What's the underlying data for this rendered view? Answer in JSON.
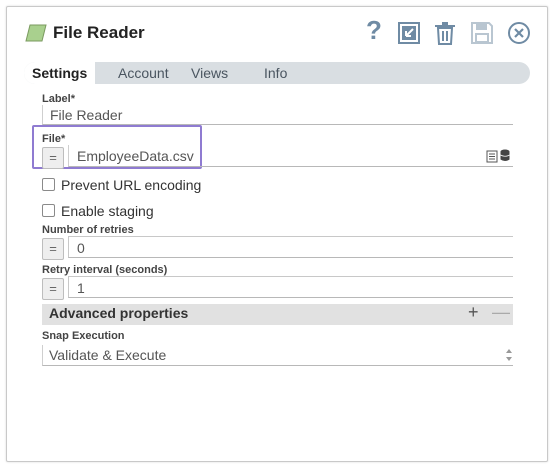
{
  "dialog": {
    "title": "File Reader",
    "header_icons": [
      "snap-type-icon",
      "help-icon",
      "export-icon",
      "delete-icon",
      "save-icon",
      "close-icon"
    ],
    "help_label": "?"
  },
  "tabs": [
    {
      "label": "Settings",
      "active": true
    },
    {
      "label": "Account",
      "active": false
    },
    {
      "label": "Views",
      "active": false
    },
    {
      "label": "Info",
      "active": false
    }
  ],
  "form": {
    "label_field": {
      "label": "Label*",
      "value": "File Reader"
    },
    "file_field": {
      "label": "File*",
      "value": "EmployeeData.csv",
      "expr_toggle": "="
    },
    "prevent_url_encoding": {
      "label": "Prevent URL encoding",
      "checked": false
    },
    "enable_staging": {
      "label": "Enable staging",
      "checked": false
    },
    "number_of_retries": {
      "label": "Number of retries",
      "value": "0",
      "expr_toggle": "="
    },
    "retry_interval": {
      "label": "Retry interval (seconds)",
      "value": "1",
      "expr_toggle": "="
    },
    "advanced": {
      "title": "Advanced properties",
      "add": "+",
      "remove": "—"
    },
    "snap_execution": {
      "label": "Snap Execution",
      "value": "Validate & Execute"
    }
  },
  "colors": {
    "highlight": "#8f7bd1",
    "snap_icon": "#a9d08e",
    "header_icon": "#6f8ba4"
  }
}
